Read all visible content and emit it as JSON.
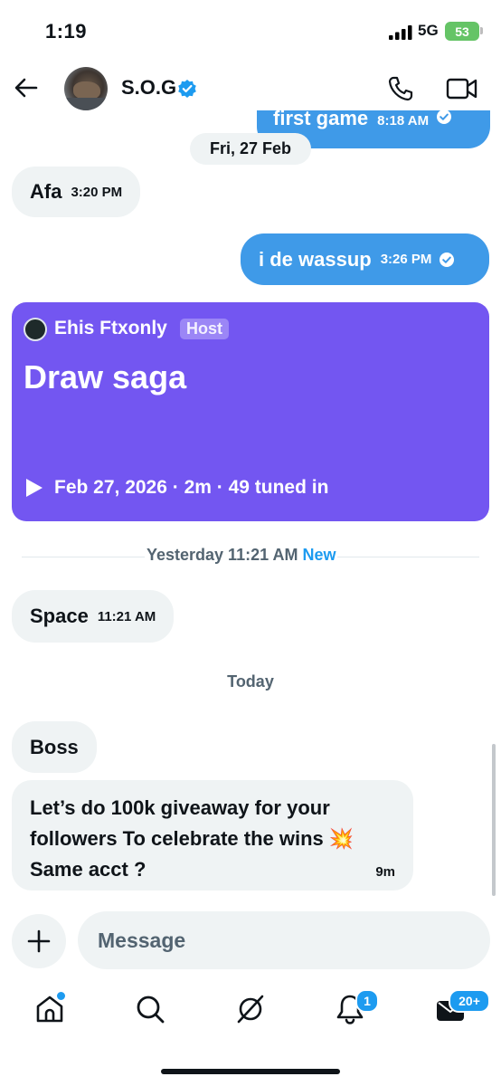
{
  "status_bar": {
    "time": "1:19",
    "network": "5G",
    "battery": "53"
  },
  "header": {
    "contact_name": "S.O.G"
  },
  "messages": {
    "top_partial": {
      "text": "first game",
      "time": "8:18 AM"
    },
    "date_divider": "Fri, 27 Feb",
    "afa": {
      "text": "Afa",
      "time": "3:20 PM"
    },
    "wassup": {
      "text": "i de wassup",
      "time": "3:26 PM"
    },
    "space_card": {
      "host": "Ehis Ftxonly",
      "host_badge": "Host",
      "title": "Draw saga",
      "meta": "Feb 27, 2026 · 2m · 49 tuned in"
    },
    "new_separator": {
      "label": "Yesterday 11:21 AM",
      "new_label": "New"
    },
    "space_msg": {
      "text": "Space",
      "time": "11:21 AM"
    },
    "today_label": "Today",
    "boss": {
      "text": "Boss"
    },
    "giveaway": {
      "line1": "Let’s do 100k giveaway for your",
      "line2": "followers To celebrate the wins 💥",
      "line3": "Same acct ?",
      "time": "9m"
    }
  },
  "composer": {
    "placeholder": "Message"
  },
  "bottom_nav": {
    "notifications_badge": "1",
    "messages_badge": "20+"
  },
  "colors": {
    "accent": "#1d9bf0",
    "outgoing_bubble": "#3f9ae8",
    "space_card": "#7356f1"
  }
}
